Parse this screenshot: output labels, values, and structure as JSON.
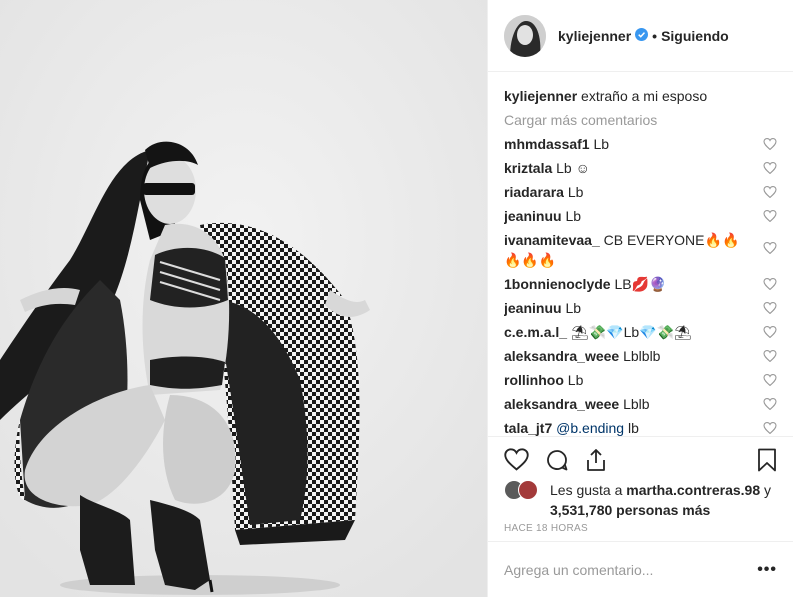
{
  "post": {
    "username": "kyliejenner",
    "verified_icon": "verified-badge-icon",
    "follow_status": "Siguiendo",
    "separator": "•"
  },
  "caption": {
    "username": "kyliejenner",
    "text": "extraño a mi esposo"
  },
  "load_more": "Cargar más comentarios",
  "comments": [
    {
      "user": "mhmdassaf1",
      "text": "Lb"
    },
    {
      "user": "kriztala",
      "text": "Lb ☺"
    },
    {
      "user": "riadarara",
      "text": "Lb"
    },
    {
      "user": "jeaninuu",
      "text": "Lb"
    },
    {
      "user": "ivanamitevaa_",
      "text": "CB EVERYONE🔥🔥🔥🔥🔥"
    },
    {
      "user": "1bonnienoclyde",
      "text": "LB💋🔮"
    },
    {
      "user": "jeaninuu",
      "text": "Lb"
    },
    {
      "user": "c.e.m.a.l_",
      "text": "⛱💸💎Lb💎💸⛱"
    },
    {
      "user": "aleksandra_weee",
      "text": "Lblblb"
    },
    {
      "user": "rollinhoo",
      "text": "Lb"
    },
    {
      "user": "aleksandra_weee",
      "text": "Lblb"
    },
    {
      "user": "tala_jt7",
      "mention": "@b.ending",
      "text": "lb"
    }
  ],
  "likes": {
    "prefix": "Les gusta a",
    "user": "martha.contreras.98",
    "joiner": "y",
    "count": "3,531,780 personas más"
  },
  "timestamp": "HACE 18 HORAS",
  "comment_input": {
    "placeholder": "Agrega un comentario...",
    "more": "•••"
  },
  "colors": {
    "link": "#003569",
    "muted": "#999999",
    "verified": "#3897f0"
  }
}
